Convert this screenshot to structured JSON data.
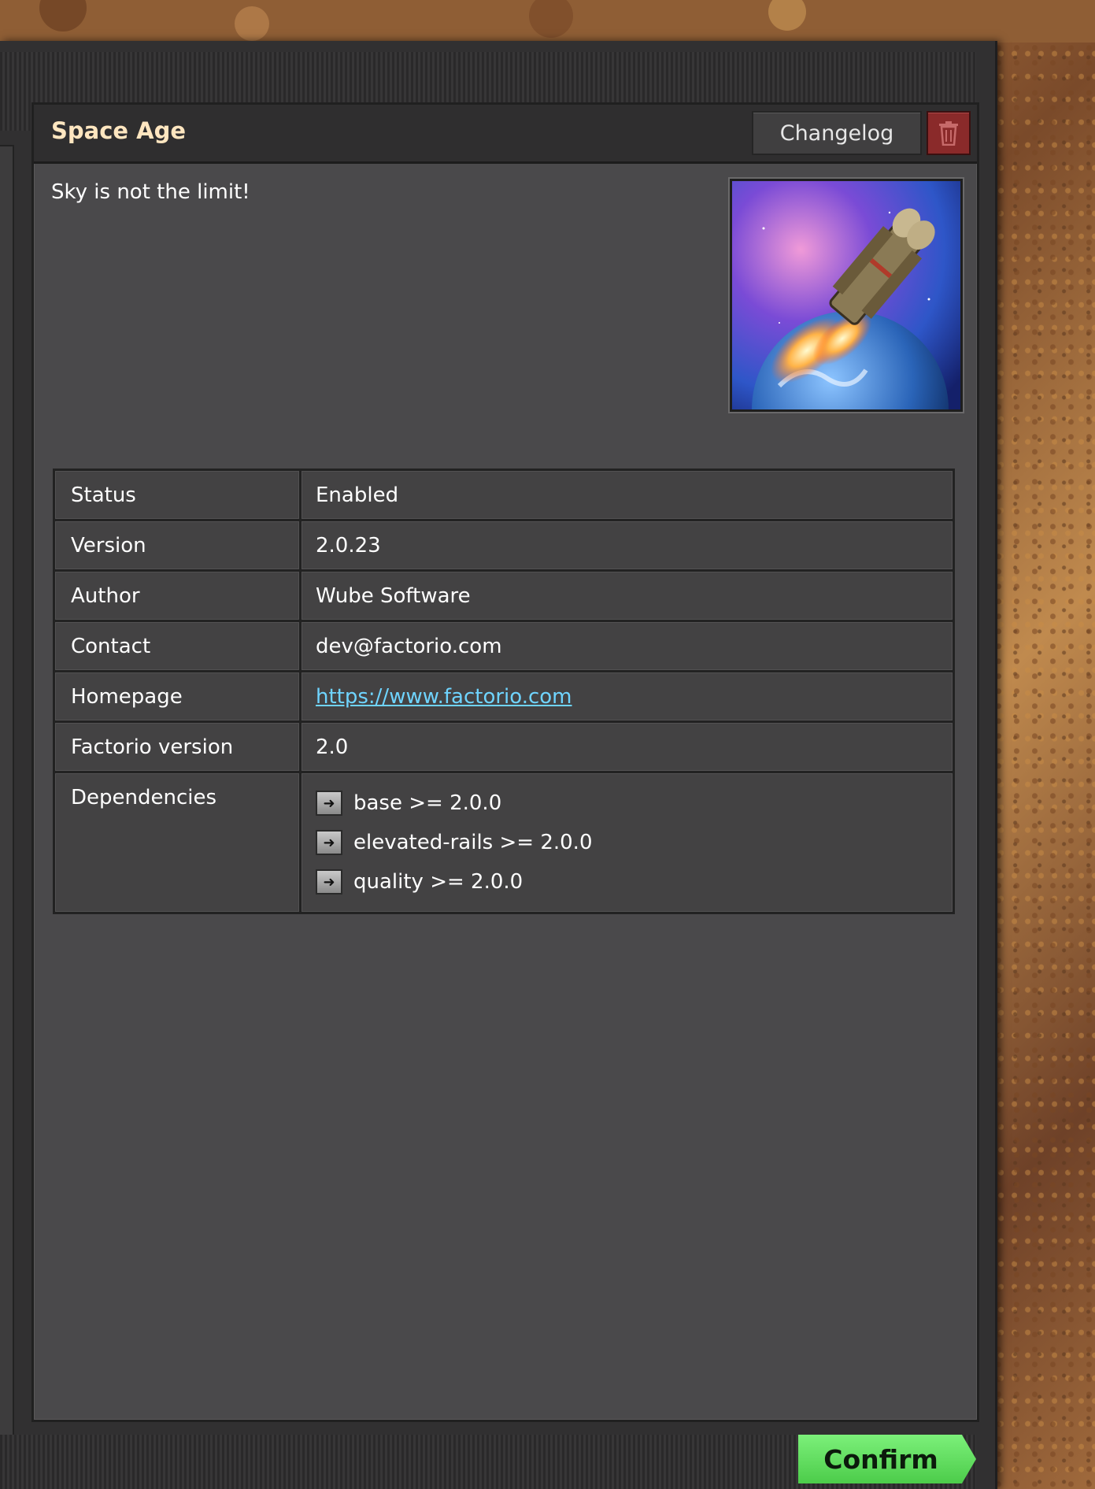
{
  "mod": {
    "title": "Space Age",
    "description": "Sky is not the limit!"
  },
  "buttons": {
    "changelog": "Changelog",
    "confirm": "Confirm"
  },
  "info_rows": [
    {
      "key": "Status",
      "value": "Enabled"
    },
    {
      "key": "Version",
      "value": "2.0.23"
    },
    {
      "key": "Author",
      "value": "Wube Software"
    },
    {
      "key": "Contact",
      "value": "dev@factorio.com"
    },
    {
      "key": "Homepage",
      "value": "https://www.factorio.com"
    },
    {
      "key": "Factorio version",
      "value": "2.0"
    }
  ],
  "dependencies": {
    "label": "Dependencies",
    "items": [
      "base >= 2.0.0",
      "elevated-rails >= 2.0.0",
      "quality >= 2.0.0"
    ]
  },
  "icons": {
    "delete": "trash-icon",
    "dependency": "arrow-right-icon",
    "thumbnail": "rocket-thumbnail"
  },
  "colors": {
    "title": "#ffe6c0",
    "link": "#6fd4ff",
    "confirm": "#5ed95c",
    "delete": "#8a2a2a"
  }
}
